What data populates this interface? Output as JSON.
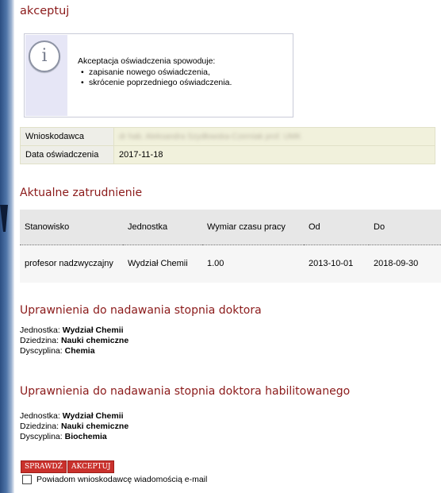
{
  "page_title": "akceptuj",
  "info": {
    "icon": "info-icon",
    "glyph": "i",
    "heading": "Akceptacja oświadczenia spowoduje:",
    "items": [
      "zapisanie nowego oświadczenia,",
      "skrócenie poprzedniego oświadczenia."
    ]
  },
  "applicant": {
    "label_applicant": "Wnioskodawca",
    "value_applicant": "dr hab. Aleksandra Szydłowska-Czerniak prof. UMK",
    "label_date": "Data oświadczenia",
    "value_date": "2017-11-18"
  },
  "employment": {
    "heading": "Aktualne zatrudnienie",
    "columns": [
      "Stanowisko",
      "Jednostka",
      "Wymiar czasu pracy",
      "Od",
      "Do"
    ],
    "rows": [
      [
        "profesor nadzwyczajny",
        "Wydział Chemii",
        "1.00",
        "2013-10-01",
        "2018-09-30"
      ]
    ]
  },
  "rights_doctor": {
    "heading": "Uprawnienia do nadawania stopnia doktora",
    "unit_label": "Jednostka:",
    "unit_value": "Wydział Chemii",
    "field_label": "Dziedzina:",
    "field_value": "Nauki chemiczne",
    "discipline_label": "Dyscyplina:",
    "discipline_value": "Chemia"
  },
  "rights_habil": {
    "heading": "Uprawnienia do nadawania stopnia doktora habilitowanego",
    "unit_label": "Jednostka:",
    "unit_value": "Wydział Chemii",
    "field_label": "Dziedzina:",
    "field_value": "Nauki chemiczne",
    "discipline_label": "Dyscyplina:",
    "discipline_value": "Biochemia"
  },
  "actions": {
    "check_label": "SPRAWDŹ",
    "accept_label": "AKCEPTUJ",
    "notify_label": "Powiadom wnioskodawcę wiadomością e-mail",
    "notify_checked": false
  },
  "colors": {
    "heading": "#8b1a1a",
    "button": "#c9312c",
    "info_bg": "#e6e6f6",
    "applicant_bg": "#f1f1dc"
  }
}
